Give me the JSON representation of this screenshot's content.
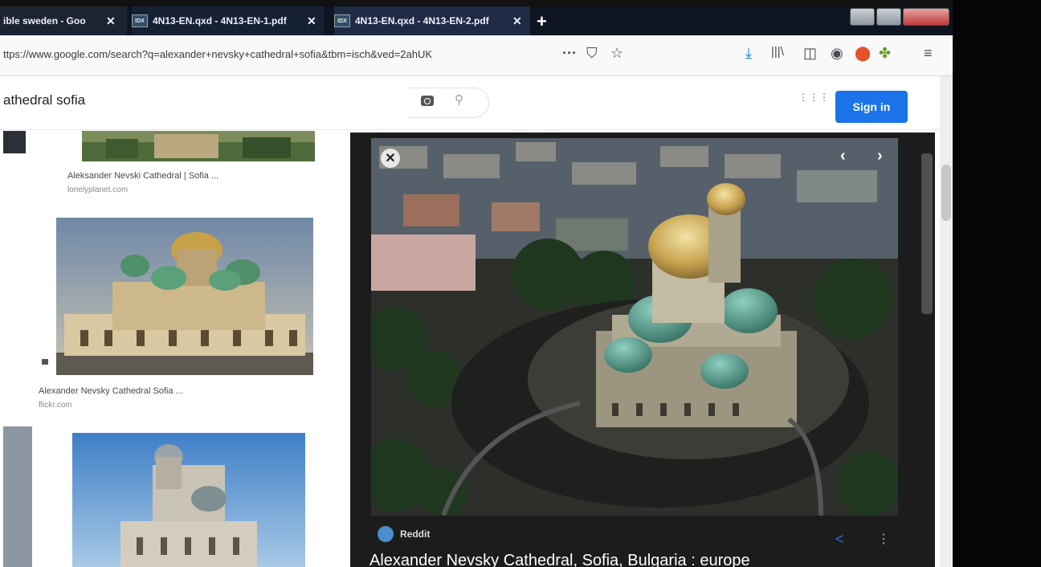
{
  "tabs": [
    {
      "label": "ible sweden - Goo"
    },
    {
      "label": "4N13-EN.qxd - 4N13-EN-1.pdf"
    },
    {
      "label": "4N13-EN.qxd - 4N13-EN-2.pdf"
    }
  ],
  "tab_close_glyph": "✕",
  "new_tab_glyph": "+",
  "url": "ttps://www.google.com/search?q=alexander+nevsky+cathedral+sofia&tbm=isch&ved=2ahUK",
  "toolbar_icons": [
    "more-icon",
    "pocket-icon",
    "bookmark-star-icon",
    "download-icon",
    "library-icon",
    "sidebar-icon",
    "account-icon",
    "ublock-icon",
    "extension-icon",
    "menu-icon"
  ],
  "search": {
    "query": "athedral sofia",
    "apps_glyph": "⋮⋮⋮",
    "sign_in": "Sign in"
  },
  "results": [
    {
      "caption": "Aleksander Nevski Cathedral | Sofia ...",
      "source": "lonelyplanet.com"
    },
    {
      "caption": "Alexander Nevsky Cathedral Sofia ...",
      "source": "flickr.com"
    }
  ],
  "viewer": {
    "source_name": "Reddit",
    "title": "Alexander Nevsky Cathedral, Sofia, Bulgaria : europe",
    "prev_glyph": "‹",
    "next_glyph": "›",
    "close_glyph": "✕",
    "share_glyph": "<",
    "more_glyph": "⋮"
  },
  "colors": {
    "accent": "#1a73e8",
    "tabstrip": "#0e1420",
    "panel": "#1c1c1c"
  }
}
